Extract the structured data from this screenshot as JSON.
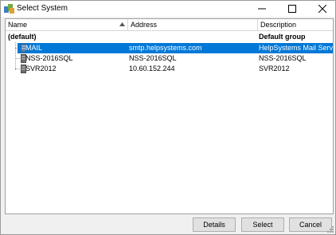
{
  "window": {
    "title": "Select System",
    "app_icon": "server-group-icon",
    "controls": [
      "minimize-icon",
      "maximize-icon",
      "close-icon"
    ]
  },
  "list": {
    "columns": [
      "Name",
      "Address",
      "Description"
    ],
    "sort_indicator": "sort-ascending-icon",
    "group": {
      "name": "(default)",
      "description": "Default group"
    },
    "rows": [
      {
        "name": "MAIL",
        "address": "smtp.helpsystems.com",
        "description": "HelpSystems Mail Server",
        "selected": true,
        "icon": "server-icon"
      },
      {
        "name": "NSS-2016SQL",
        "address": "NSS-2016SQL",
        "description": "NSS-2016SQL",
        "selected": false,
        "icon": "server-icon"
      },
      {
        "name": "SVR2012",
        "address": "10.60.152.244",
        "description": "SVR2012",
        "selected": false,
        "icon": "server-icon"
      }
    ]
  },
  "buttons": {
    "details": "Details",
    "select": "Select",
    "cancel": "Cancel"
  },
  "colors": {
    "selection": "#0078d7",
    "selection_text": "#ffffff"
  }
}
